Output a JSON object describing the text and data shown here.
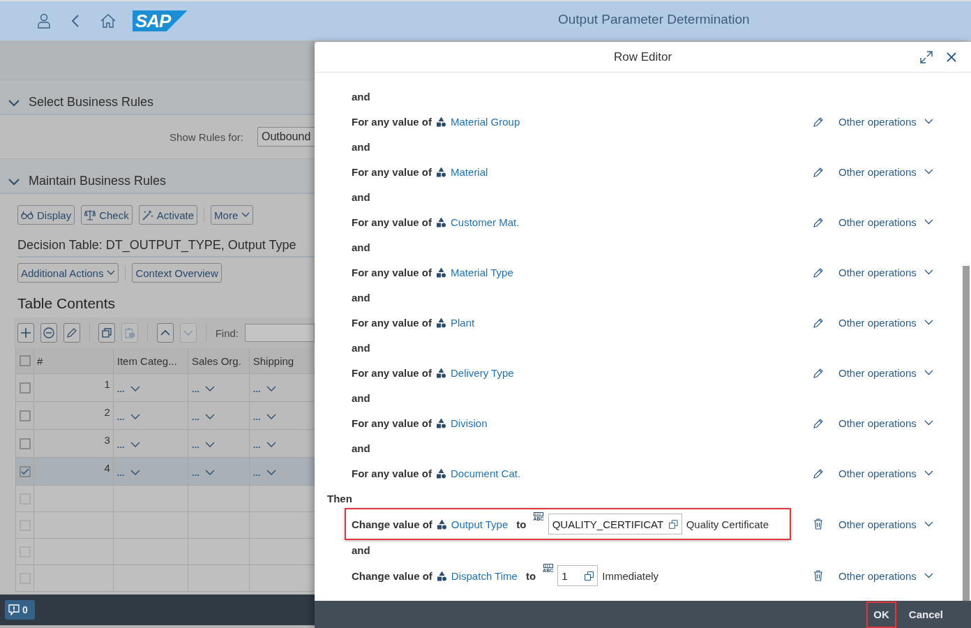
{
  "shell": {
    "logo": "SAP",
    "title": "Output Parameter Determination"
  },
  "sections": [
    {
      "title": "Select Business Rules",
      "expanded": true
    },
    {
      "title": "Maintain Business Rules",
      "expanded": true
    }
  ],
  "show_rules": {
    "label": "Show Rules for:",
    "value": "Outbound"
  },
  "toolbar": [
    {
      "label": "Display",
      "kind": "display"
    },
    {
      "label": "Check",
      "kind": "check"
    },
    {
      "label": "Activate",
      "kind": "activate"
    },
    {
      "label": "More",
      "kind": "menu"
    }
  ],
  "decision_table_title": "Decision Table: DT_OUTPUT_TYPE, Output Type",
  "actions": [
    {
      "label": "Additional Actions",
      "kind": "menu"
    },
    {
      "label": "Context Overview",
      "kind": "plain"
    }
  ],
  "table": {
    "title": "Table Contents",
    "tools": [
      {
        "kind": "add",
        "disabled": false
      },
      {
        "kind": "remove",
        "disabled": false
      },
      {
        "kind": "edit",
        "disabled": false
      },
      {
        "kind": "copy",
        "disabled": false
      },
      {
        "kind": "paste",
        "disabled": true
      },
      {
        "kind": "up",
        "disabled": false
      },
      {
        "kind": "down",
        "disabled": true
      }
    ],
    "find_label": "Find:",
    "select_all_checked": false,
    "columns": [
      "#",
      "Item Categ...",
      "Sales Org.",
      "Shipping"
    ],
    "rows": [
      {
        "selected": false,
        "cells": [
          "1",
          "...",
          "...",
          "..."
        ]
      },
      {
        "selected": false,
        "cells": [
          "2",
          "...",
          "...",
          "..."
        ]
      },
      {
        "selected": false,
        "cells": [
          "3",
          "...",
          "...",
          "..."
        ]
      },
      {
        "selected": true,
        "cells": [
          "4",
          "...",
          "...",
          "..."
        ]
      }
    ],
    "empty_rows": [
      {
        "selected": false
      },
      {
        "selected": false
      },
      {
        "selected": false
      },
      {
        "selected": false
      }
    ]
  },
  "messages": {
    "count": "0"
  },
  "dialog": {
    "title": "Row Editor",
    "items": [
      {
        "kind": "connector",
        "text": "and"
      },
      {
        "kind": "condition",
        "prefix": "For any value of",
        "field": "Material Group",
        "operations": "Other operations"
      },
      {
        "kind": "connector",
        "text": "and"
      },
      {
        "kind": "condition",
        "prefix": "For any value of",
        "field": "Material",
        "operations": "Other operations"
      },
      {
        "kind": "connector",
        "text": "and"
      },
      {
        "kind": "condition",
        "prefix": "For any value of",
        "field": "Customer Mat.",
        "operations": "Other operations"
      },
      {
        "kind": "connector",
        "text": "and"
      },
      {
        "kind": "condition",
        "prefix": "For any value of",
        "field": "Material Type",
        "operations": "Other operations"
      },
      {
        "kind": "connector",
        "text": "and"
      },
      {
        "kind": "condition",
        "prefix": "For any value of",
        "field": "Plant",
        "operations": "Other operations"
      },
      {
        "kind": "connector",
        "text": "and"
      },
      {
        "kind": "condition",
        "prefix": "For any value of",
        "field": "Delivery Type",
        "operations": "Other operations"
      },
      {
        "kind": "connector",
        "text": "and"
      },
      {
        "kind": "condition",
        "prefix": "For any value of",
        "field": "Division",
        "operations": "Other operations"
      },
      {
        "kind": "connector",
        "text": "and"
      },
      {
        "kind": "condition",
        "prefix": "For any value of",
        "field": "Document Cat.",
        "operations": "Other operations"
      },
      {
        "kind": "heading",
        "text": "Then"
      },
      {
        "kind": "action",
        "prefix": "Change value of",
        "field": "Output Type",
        "to": "to",
        "type_label": "ABC",
        "value": "QUALITY_CERTIFICAT",
        "description": "Quality Certificate",
        "operations": "Other operations",
        "highlighted": true
      },
      {
        "kind": "connector",
        "text": "and"
      },
      {
        "kind": "action",
        "prefix": "Change value of",
        "field": "Dispatch Time",
        "to": "to",
        "type_label": "ABC",
        "value": "1",
        "description": "Immediately",
        "operations": "Other operations",
        "highlighted": false
      }
    ],
    "buttons": [
      {
        "label": "OK",
        "highlighted": true
      },
      {
        "label": "Cancel",
        "highlighted": false
      }
    ]
  }
}
